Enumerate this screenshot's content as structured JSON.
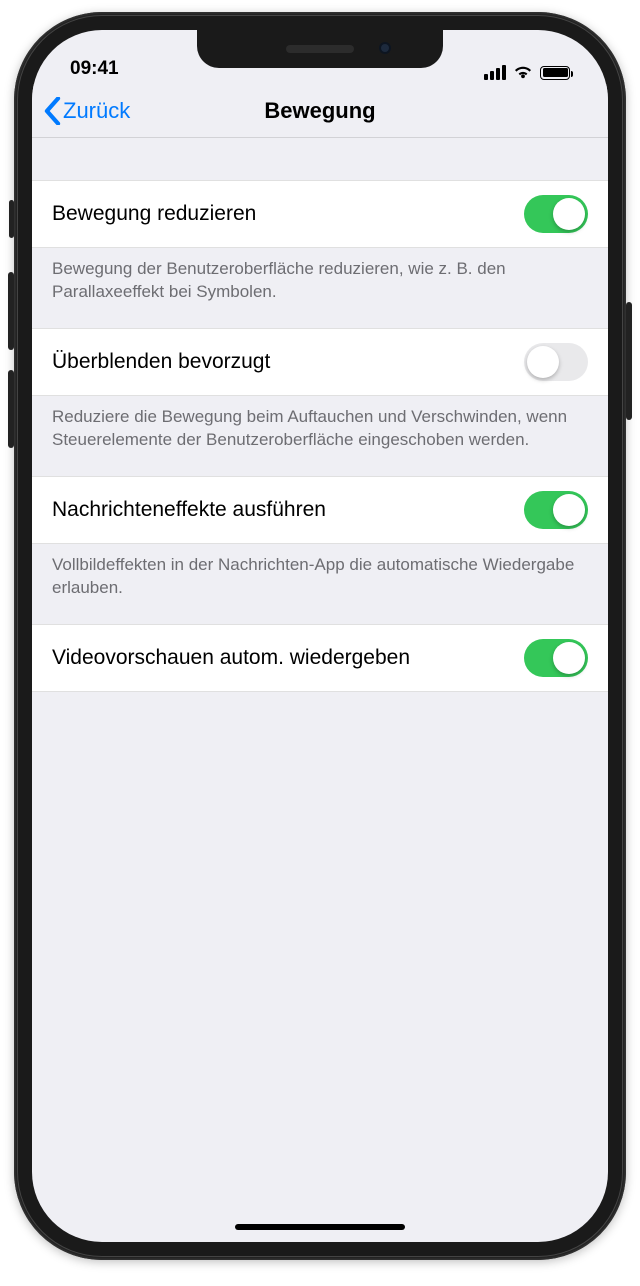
{
  "status": {
    "time": "09:41"
  },
  "nav": {
    "back": "Zurück",
    "title": "Bewegung"
  },
  "rows": [
    {
      "label": "Bewegung reduzieren",
      "on": true,
      "footer": "Bewegung der Benutzeroberfläche reduzieren, wie z. B. den Parallaxeeffekt bei Symbolen."
    },
    {
      "label": "Überblenden bevorzugt",
      "on": false,
      "footer": "Reduziere die Bewegung beim Auftauchen und Verschwinden, wenn Steuerelemente der Benutzeroberfläche eingeschoben werden."
    },
    {
      "label": "Nachrichteneffekte ausführen",
      "on": true,
      "footer": "Vollbildeffekten in der Nachrichten-App die automatische Wiedergabe erlauben."
    },
    {
      "label": "Videovorschauen autom. wiedergeben",
      "on": true,
      "footer": ""
    }
  ]
}
